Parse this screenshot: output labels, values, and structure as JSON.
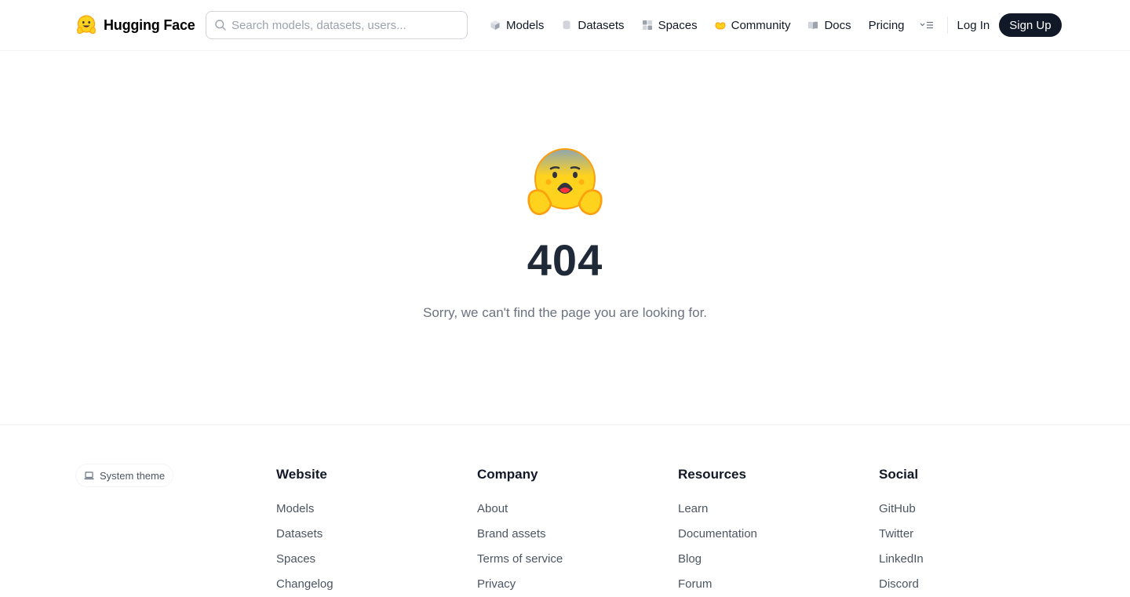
{
  "header": {
    "brand_name": "Hugging Face",
    "search_placeholder": "Search models, datasets, users...",
    "nav": [
      {
        "label": "Models",
        "icon": "cube-icon"
      },
      {
        "label": "Datasets",
        "icon": "database-icon"
      },
      {
        "label": "Spaces",
        "icon": "grid-icon"
      },
      {
        "label": "Community",
        "icon": "hands-icon"
      },
      {
        "label": "Docs",
        "icon": "book-icon"
      },
      {
        "label": "Pricing"
      }
    ],
    "more_icon": "menu-icon",
    "login_label": "Log In",
    "signup_label": "Sign Up"
  },
  "main": {
    "emoji": "scared-hugging-face-icon",
    "code": "404",
    "message": "Sorry, we can't find the page you are looking for."
  },
  "footer": {
    "theme_label": "System theme",
    "columns": [
      {
        "title": "Website",
        "links": [
          "Models",
          "Datasets",
          "Spaces",
          "Changelog"
        ]
      },
      {
        "title": "Company",
        "links": [
          "About",
          "Brand assets",
          "Terms of service",
          "Privacy"
        ]
      },
      {
        "title": "Resources",
        "links": [
          "Learn",
          "Documentation",
          "Blog",
          "Forum"
        ]
      },
      {
        "title": "Social",
        "links": [
          "GitHub",
          "Twitter",
          "LinkedIn",
          "Discord"
        ]
      }
    ]
  },
  "colors": {
    "primary_dark": "#111827",
    "muted_text": "#6b7280",
    "emoji_yellow": "#FFD21E",
    "emoji_orange": "#FF9D0B"
  }
}
